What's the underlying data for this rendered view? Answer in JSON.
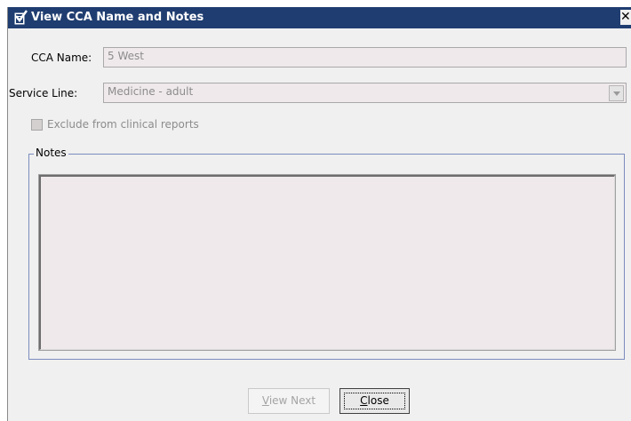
{
  "window": {
    "title": "View CCA Name and Notes",
    "close_glyph": "✕",
    "icon": "check-document-icon"
  },
  "form": {
    "cca_name_label": "CCA Name:",
    "cca_name_value": "5 West",
    "service_line_label": "Service Line:",
    "service_line_value": "Medicine - adult",
    "exclude_label": "Exclude from clinical reports",
    "exclude_checked": false,
    "notes_legend": "Notes",
    "notes_value": ""
  },
  "buttons": {
    "view_next_mnemonic": "V",
    "view_next_rest": "iew Next",
    "close_mnemonic": "C",
    "close_rest": "lose"
  },
  "colors": {
    "titlebar": "#1f3d70",
    "dialog_bg": "#f0f0f0",
    "field_bg": "#efe9ec",
    "group_border": "#7c8cbd"
  }
}
